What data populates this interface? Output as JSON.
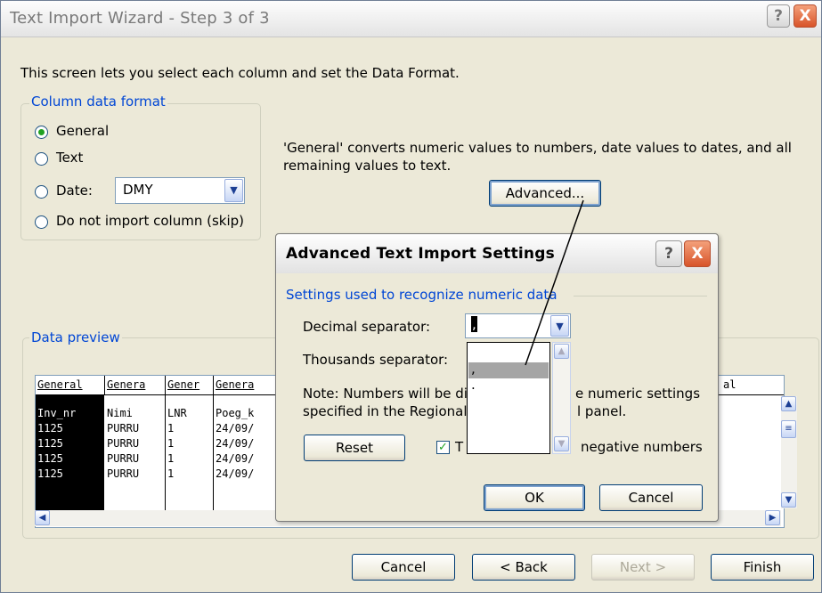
{
  "window": {
    "title": "Text Import Wizard - Step 3 of 3",
    "help_label": "?",
    "close_label": "X"
  },
  "intro_text": "This screen lets you select each column and set the Data Format.",
  "column_format": {
    "legend": "Column data format",
    "general_label": "General",
    "text_label": "Text",
    "date_label": "Date:",
    "date_value": "DMY",
    "skip_label": "Do not import column (skip)",
    "selected": "general"
  },
  "general_note_line1": "'General' converts numeric values to numbers, date values to dates, and all",
  "general_note_line2": "remaining values to text.",
  "advanced_button": "Advanced...",
  "preview": {
    "legend": "Data preview",
    "headers": [
      "General",
      "Genera",
      "Gener",
      "Genera",
      "al"
    ],
    "rows": [
      [
        "Inv_nr",
        "Nimi",
        "LNR",
        "Poeg_k"
      ],
      [
        "1125",
        "PURRU",
        "1",
        "24/09/"
      ],
      [
        "1125",
        "PURRU",
        "1",
        "24/09/"
      ],
      [
        "1125",
        "PURRU",
        "1",
        "24/09/"
      ],
      [
        "1125",
        "PURRU",
        "1",
        "24/09/"
      ]
    ]
  },
  "buttons": {
    "cancel": "Cancel",
    "back": "< Back",
    "next": "Next >",
    "finish": "Finish"
  },
  "advanced_dialog": {
    "title": "Advanced Text Import Settings",
    "section": "Settings used to recognize numeric data",
    "decimal_label": "Decimal separator:",
    "decimal_value": ",",
    "thousands_label": "Thousands separator:",
    "thousands_value": ",",
    "note_line1_a": "Note: Numbers will be di",
    "note_line1_b": "e numeric settings",
    "note_line2_a": "specified in the Regional",
    "note_line2_b": "l panel.",
    "reset_button": "Reset",
    "trailing_minus_a": "T",
    "trailing_minus_b": "negative numbers",
    "trailing_minus_checked": true,
    "ok_button": "OK",
    "cancel_button": "Cancel",
    "dropdown_options": [
      "",
      ",",
      "."
    ],
    "dropdown_selected": ","
  },
  "colors": {
    "accent": "#0046d5",
    "dialog_bg": "#ece9d8",
    "close_button": "#d8542a"
  }
}
